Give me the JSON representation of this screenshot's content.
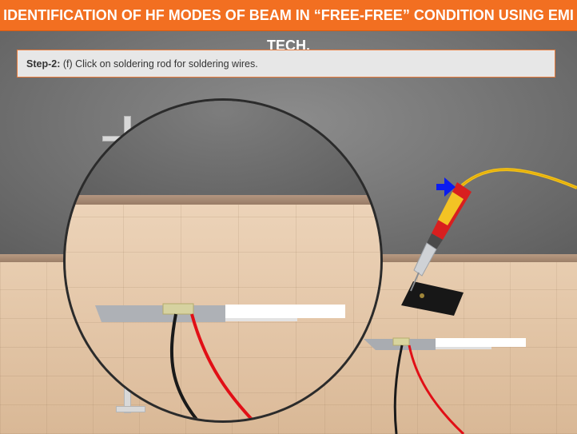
{
  "header": {
    "title": "IDENTIFICATION OF HF MODES OF BEAM IN “FREE-FREE” CONDITION USING EMI TECH."
  },
  "instruction": {
    "step_label": "Step-2:",
    "text": " (f) Click on soldering rod for soldering wires."
  },
  "colors": {
    "accent": "#f26f21",
    "pointer_arrow": "#0a1cf0",
    "cable": "#f2c11a",
    "wire_red": "#e10f16",
    "wire_black": "#1a1a1a"
  },
  "scene": {
    "pointer": "blue-arrow-icon",
    "tool": "soldering-iron-icon"
  }
}
